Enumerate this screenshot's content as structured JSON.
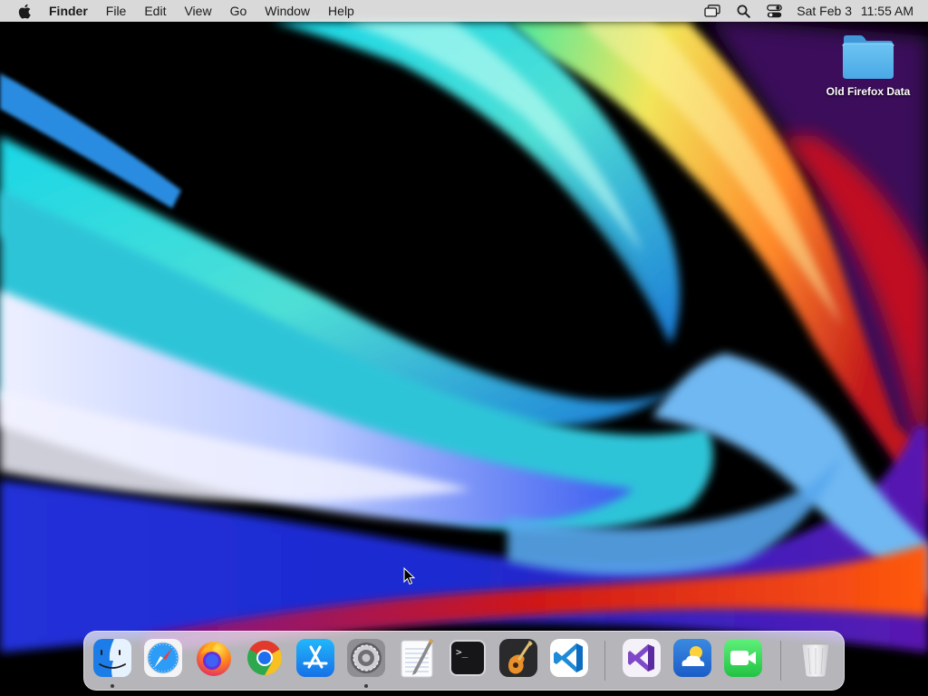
{
  "menubar": {
    "apple_icon": "apple-logo-icon",
    "app_name": "Finder",
    "menus": [
      "File",
      "Edit",
      "View",
      "Go",
      "Window",
      "Help"
    ],
    "status_icons": [
      "screen-mirroring-icon",
      "spotlight-search-icon",
      "control-center-icon"
    ],
    "date": "Sat Feb 3",
    "time": "11:55 AM"
  },
  "desktop": {
    "items": [
      {
        "label": "Old Firefox Data",
        "icon": "folder-icon"
      }
    ]
  },
  "dock": {
    "apps": [
      {
        "icon": "finder-icon",
        "running": true
      },
      {
        "icon": "safari-icon",
        "running": false
      },
      {
        "icon": "firefox-icon",
        "running": false
      },
      {
        "icon": "chrome-icon",
        "running": false
      },
      {
        "icon": "app-store-icon",
        "running": false
      },
      {
        "icon": "system-preferences-icon",
        "running": true
      },
      {
        "icon": "textedit-icon",
        "running": false
      },
      {
        "icon": "terminal-icon",
        "running": false
      },
      {
        "icon": "garageband-icon",
        "running": false
      },
      {
        "icon": "vscode-icon",
        "running": false
      },
      {
        "icon": "visual-studio-icon",
        "running": false
      },
      {
        "icon": "weather-icon",
        "running": false
      },
      {
        "icon": "facetime-icon",
        "running": false
      },
      {
        "icon": "trash-icon",
        "running": false
      }
    ],
    "terminal_prompt": ">_"
  },
  "colors": {
    "menubar_bg": "#ececec",
    "folder_blue": "#5fb7ec",
    "dock_bg": "#e8e8ee"
  }
}
